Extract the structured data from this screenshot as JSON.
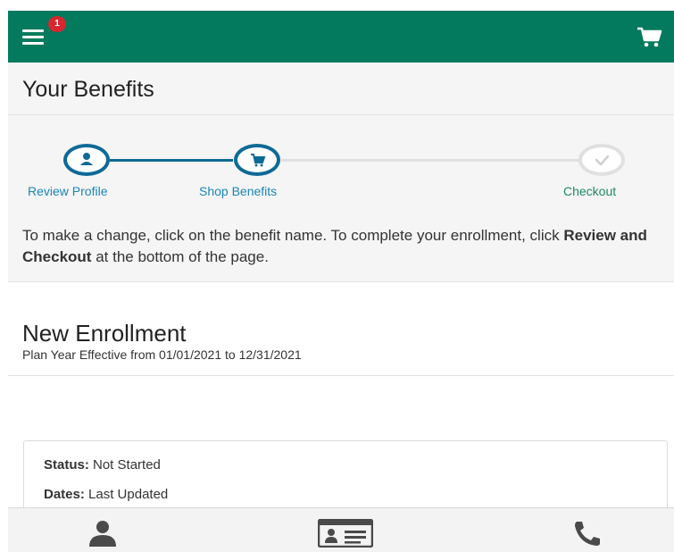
{
  "header": {
    "menu_icon": "hamburger-menu-icon",
    "notification_count": "1",
    "cart_icon": "shopping-cart-icon",
    "bar_color": "#037a5d"
  },
  "page": {
    "title": "Your Benefits"
  },
  "stepper": {
    "steps": [
      {
        "label": "Review Profile",
        "icon": "user-icon",
        "state": "complete"
      },
      {
        "label": "Shop Benefits",
        "icon": "cart-icon",
        "state": "current"
      },
      {
        "label": "Checkout",
        "icon": "check-icon",
        "state": "upcoming"
      }
    ]
  },
  "instructions": {
    "part1": "To make a change, click on the benefit name. To complete your enrollment, click ",
    "bold": "Review and Checkout",
    "part2": " at the bottom of the page."
  },
  "enrollment": {
    "title": "New Enrollment",
    "subtitle": "Plan Year Effective from 01/01/2021 to 12/31/2021"
  },
  "card": {
    "status_label": "Status:",
    "status_value": " Not Started",
    "dates_label": "Dates:",
    "dates_value": " Last Updated"
  },
  "bottom_nav": {
    "items": [
      {
        "icon": "profile-icon"
      },
      {
        "icon": "id-card-icon"
      },
      {
        "icon": "phone-icon"
      }
    ]
  }
}
